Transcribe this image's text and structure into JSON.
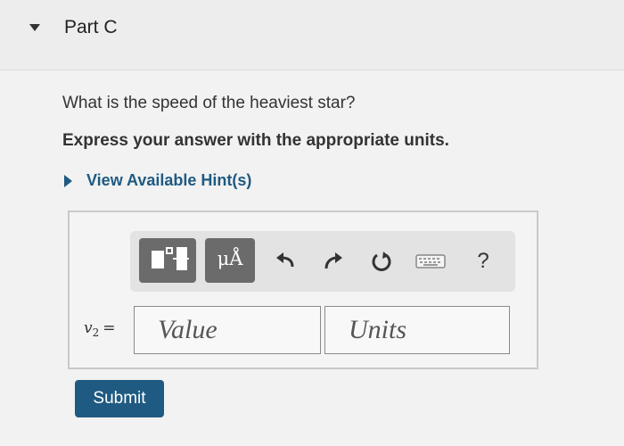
{
  "part": {
    "title": "Part C"
  },
  "question": {
    "text": "What is the speed of the heaviest star?",
    "instruction": "Express your answer with the appropriate units."
  },
  "hint": {
    "label": "View Available Hint(s)"
  },
  "toolbar": {
    "units_label": "μÅ",
    "help_label": "?",
    "icons": [
      "templates-icon",
      "units-icon",
      "undo-icon",
      "redo-icon",
      "reset-icon",
      "keyboard-icon",
      "help-icon"
    ]
  },
  "answer": {
    "variable": "v",
    "subscript": "2",
    "equals": "=",
    "value_placeholder": "Value",
    "units_placeholder": "Units"
  },
  "submit": {
    "label": "Submit"
  },
  "colors": {
    "accent": "#1f5a82",
    "toolbar_button": "#6b6b6b"
  }
}
